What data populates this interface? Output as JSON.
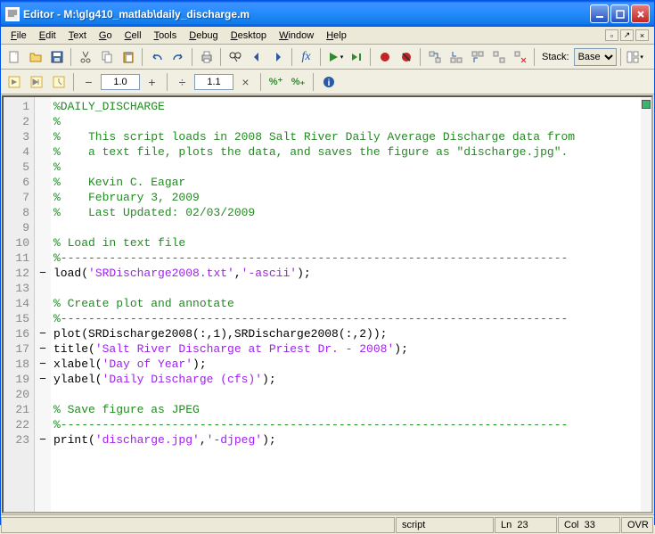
{
  "title": "Editor - M:\\glg410_matlab\\daily_discharge.m",
  "menu": [
    "File",
    "Edit",
    "Text",
    "Go",
    "Cell",
    "Tools",
    "Debug",
    "Desktop",
    "Window",
    "Help"
  ],
  "toolbar": {
    "stack_label": "Stack:",
    "stack_value": "Base"
  },
  "toolbar2": {
    "val1": "1.0",
    "val2": "1.1"
  },
  "code": {
    "lines": [
      {
        "n": 1,
        "m": "",
        "segs": [
          {
            "c": "cm",
            "t": "%DAILY_DISCHARGE"
          }
        ]
      },
      {
        "n": 2,
        "m": "",
        "segs": [
          {
            "c": "cm",
            "t": "%"
          }
        ]
      },
      {
        "n": 3,
        "m": "",
        "segs": [
          {
            "c": "cm",
            "t": "%    This script loads in 2008 Salt River Daily Average Discharge data from"
          }
        ]
      },
      {
        "n": 4,
        "m": "",
        "segs": [
          {
            "c": "cm",
            "t": "%    a text file, plots the data, and saves the figure as \"discharge.jpg\"."
          }
        ]
      },
      {
        "n": 5,
        "m": "",
        "segs": [
          {
            "c": "cm",
            "t": "%"
          }
        ]
      },
      {
        "n": 6,
        "m": "",
        "segs": [
          {
            "c": "cm",
            "t": "%    Kevin C. Eagar"
          }
        ]
      },
      {
        "n": 7,
        "m": "",
        "segs": [
          {
            "c": "cm",
            "t": "%    February 3, 2009"
          }
        ]
      },
      {
        "n": 8,
        "m": "",
        "segs": [
          {
            "c": "cm",
            "t": "%    Last Updated: 02/03/2009"
          }
        ]
      },
      {
        "n": 9,
        "m": "",
        "segs": []
      },
      {
        "n": 10,
        "m": "",
        "segs": [
          {
            "c": "cm",
            "t": "% Load in text file"
          }
        ]
      },
      {
        "n": 11,
        "m": "",
        "segs": [
          {
            "c": "cm",
            "t": "%-------------------------------------------------------------------------"
          }
        ]
      },
      {
        "n": 12,
        "m": "−",
        "segs": [
          {
            "c": "pl",
            "t": "load("
          },
          {
            "c": "st",
            "t": "'SRDischarge2008.txt'"
          },
          {
            "c": "pl",
            "t": ","
          },
          {
            "c": "st",
            "t": "'-ascii'"
          },
          {
            "c": "pl",
            "t": ");"
          }
        ]
      },
      {
        "n": 13,
        "m": "",
        "segs": []
      },
      {
        "n": 14,
        "m": "",
        "segs": [
          {
            "c": "cm",
            "t": "% Create plot and annotate"
          }
        ]
      },
      {
        "n": 15,
        "m": "",
        "segs": [
          {
            "c": "cm",
            "t": "%-------------------------------------------------------------------------"
          }
        ]
      },
      {
        "n": 16,
        "m": "−",
        "segs": [
          {
            "c": "pl",
            "t": "plot(SRDischarge2008(:,1),SRDischarge2008(:,2));"
          }
        ]
      },
      {
        "n": 17,
        "m": "−",
        "segs": [
          {
            "c": "pl",
            "t": "title("
          },
          {
            "c": "st",
            "t": "'Salt River Discharge at Priest Dr. - 2008'"
          },
          {
            "c": "pl",
            "t": ");"
          }
        ]
      },
      {
        "n": 18,
        "m": "−",
        "segs": [
          {
            "c": "pl",
            "t": "xlabel("
          },
          {
            "c": "st",
            "t": "'Day of Year'"
          },
          {
            "c": "pl",
            "t": ");"
          }
        ]
      },
      {
        "n": 19,
        "m": "−",
        "segs": [
          {
            "c": "pl",
            "t": "ylabel("
          },
          {
            "c": "st",
            "t": "'Daily Discharge (cfs)'"
          },
          {
            "c": "pl",
            "t": ");"
          }
        ]
      },
      {
        "n": 20,
        "m": "",
        "segs": []
      },
      {
        "n": 21,
        "m": "",
        "segs": [
          {
            "c": "cm",
            "t": "% Save figure as JPEG"
          }
        ]
      },
      {
        "n": 22,
        "m": "",
        "segs": [
          {
            "c": "cm",
            "t": "%-------------------------------------------------------------------------"
          }
        ]
      },
      {
        "n": 23,
        "m": "−",
        "segs": [
          {
            "c": "pl",
            "t": "print("
          },
          {
            "c": "st",
            "t": "'discharge.jpg'"
          },
          {
            "c": "pl",
            "t": ","
          },
          {
            "c": "st",
            "t": "'-djpeg'"
          },
          {
            "c": "pl",
            "t": ");"
          }
        ]
      }
    ]
  },
  "status": {
    "type": "script",
    "ln_label": "Ln",
    "ln": "23",
    "col_label": "Col",
    "col": "33",
    "ovr": "OVR"
  }
}
